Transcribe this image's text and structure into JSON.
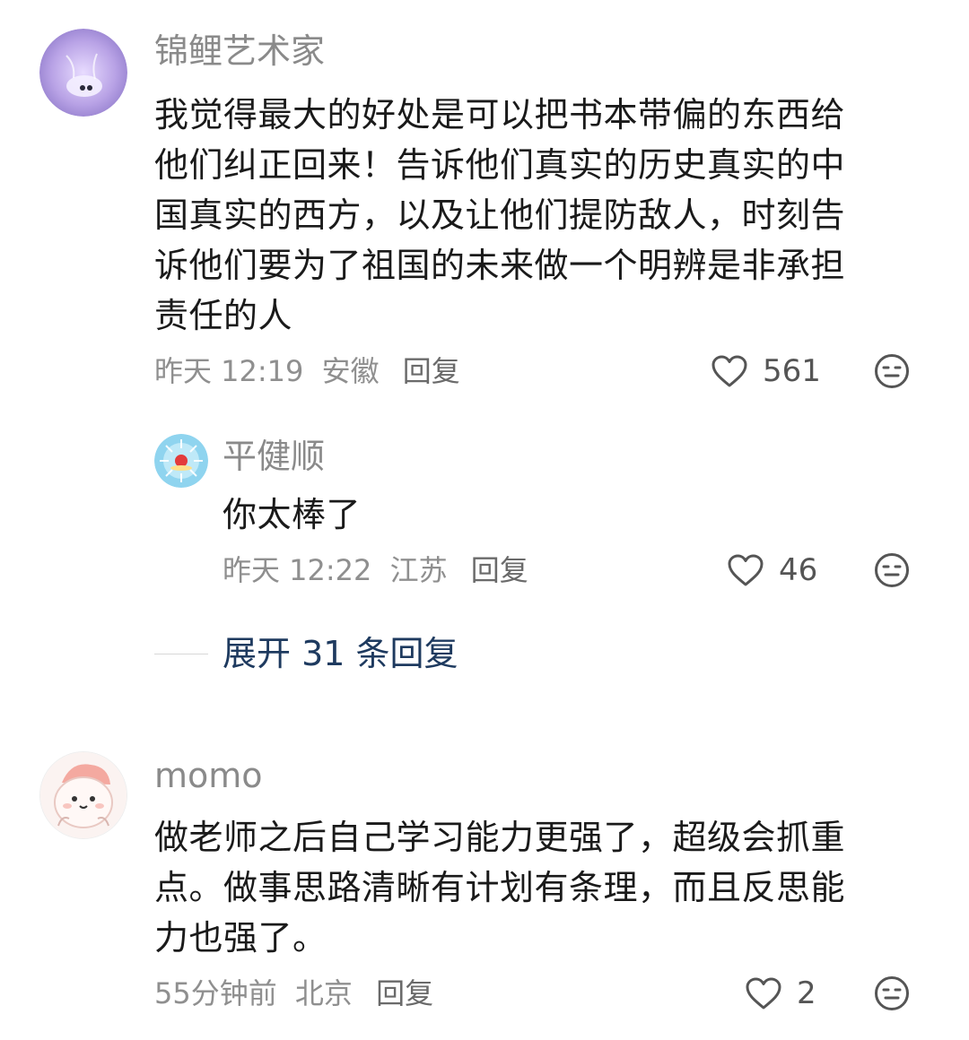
{
  "comments": [
    {
      "author": "锦鲤艺术家",
      "lines": [
        "我觉得最大的好处是可以把书本带偏的东西给",
        "他们纠正回来！告诉他们真实的历史真实的中",
        "国真实的西方，以及让他们提防敌人，时刻告",
        "诉他们要为了祖国的未来做一个明辨是非承担",
        "责任的人"
      ],
      "time": "昨天 12:19",
      "location": "安徽",
      "reply_label": "回复",
      "likes": "561",
      "avatar_icon": "koi-art-avatar"
    },
    {
      "author": "平健顺",
      "lines": [
        "你太棒了"
      ],
      "time": "昨天 12:22",
      "location": "江苏",
      "reply_label": "回复",
      "likes": "46",
      "avatar_icon": "strawberry-avatar"
    },
    {
      "author": "momo",
      "lines": [
        "做老师之后自己学习能力更强了，超级会抓重",
        "点。做事思路清晰有计划有条理，而且反思能",
        "力也强了。"
      ],
      "time": "55分钟前",
      "location": "北京",
      "reply_label": "回复",
      "likes": "2",
      "avatar_icon": "cartoon-face-avatar"
    }
  ],
  "expand_replies": "展开 31 条回复",
  "icons": {
    "like": "heart-outline-icon",
    "reaction": "neutral-face-icon"
  },
  "colors": {
    "name": "#8a8a8a",
    "text": "#1a1a1a",
    "meta": "#8f8f8f",
    "expand": "#1e3a5f"
  }
}
